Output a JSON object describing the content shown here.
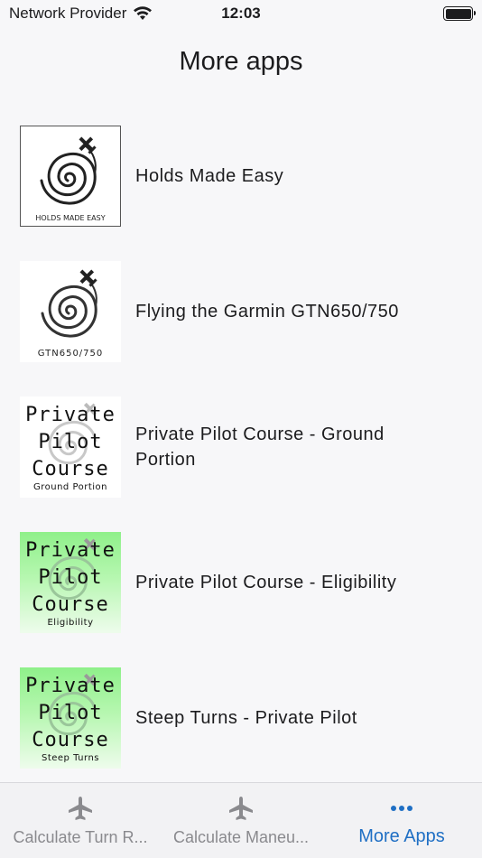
{
  "status_bar": {
    "carrier": "Network Provider",
    "time": "12:03",
    "wifi_icon": "wifi-icon",
    "battery_icon": "battery-icon"
  },
  "page": {
    "title": "More apps"
  },
  "apps": [
    {
      "name": "Holds Made Easy",
      "icon_caption": "HOLDS MADE EASY"
    },
    {
      "name": "Flying the Garmin GTN650/750",
      "icon_caption": "GTN650/750"
    },
    {
      "name": "Private Pilot Course - Ground Portion",
      "icon_title": [
        "Private",
        "Pilot",
        "Course"
      ],
      "icon_caption": "Ground Portion"
    },
    {
      "name": "Private Pilot Course - Eligibility",
      "icon_title": [
        "Private",
        "Pilot",
        "Course"
      ],
      "icon_caption": "Eligibility"
    },
    {
      "name": "Steep Turns - Private Pilot",
      "icon_title": [
        "Private",
        "Pilot",
        "Course"
      ],
      "icon_caption": "Steep Turns"
    }
  ],
  "tab_bar": {
    "tabs": [
      {
        "label": "Calculate Turn R...",
        "icon": "airplane-icon",
        "active": false
      },
      {
        "label": "Calculate Maneu...",
        "icon": "airplane-icon",
        "active": false
      },
      {
        "label": "More Apps",
        "icon": "more-dots-icon",
        "active": true
      }
    ],
    "active_color": "#1f6fc4",
    "inactive_color": "#8a8a8e"
  }
}
